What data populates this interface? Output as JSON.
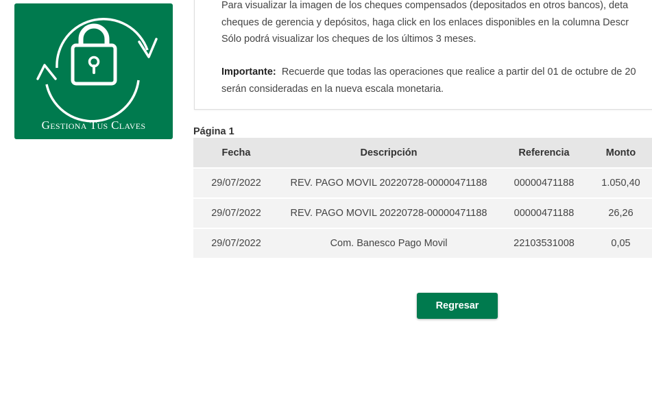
{
  "promo": {
    "label": "Gestiona Tus Claves",
    "icon": "padlock-refresh-icon"
  },
  "notice": {
    "paragraph1_lines": [
      "Para visualizar la imagen de los cheques compensados (depositados en otros bancos), deta",
      "cheques de gerencia y depósitos, haga click en los enlaces disponibles en la columna Descr",
      "Sólo podrá visualizar los cheques de los últimos 3 meses."
    ],
    "important_label": "Importante:",
    "important_line1": "Recuerde que todas las operaciones que realice a partir del 01 de octubre de 20",
    "important_line2": "serán consideradas en la nueva escala monetaria."
  },
  "page_label": "Página 1",
  "table": {
    "headers": {
      "fecha": "Fecha",
      "descripcion": "Descripción",
      "referencia": "Referencia",
      "monto": "Monto"
    },
    "rows": [
      {
        "fecha": "29/07/2022",
        "descripcion": "REV. PAGO MOVIL 20220728-00000471188",
        "referencia": "00000471188",
        "monto": "1.050,40"
      },
      {
        "fecha": "29/07/2022",
        "descripcion": "REV. PAGO MOVIL 20220728-00000471188",
        "referencia": "00000471188",
        "monto": "26,26"
      },
      {
        "fecha": "29/07/2022",
        "descripcion": "Com. Banesco Pago Movil",
        "referencia": "22103531008",
        "monto": "0,05"
      }
    ]
  },
  "buttons": {
    "back_label": "Regresar"
  },
  "colors": {
    "brand_green": "#007a4e",
    "header_bg": "#e6e6e6",
    "row_bg": "#f3f3f3"
  }
}
